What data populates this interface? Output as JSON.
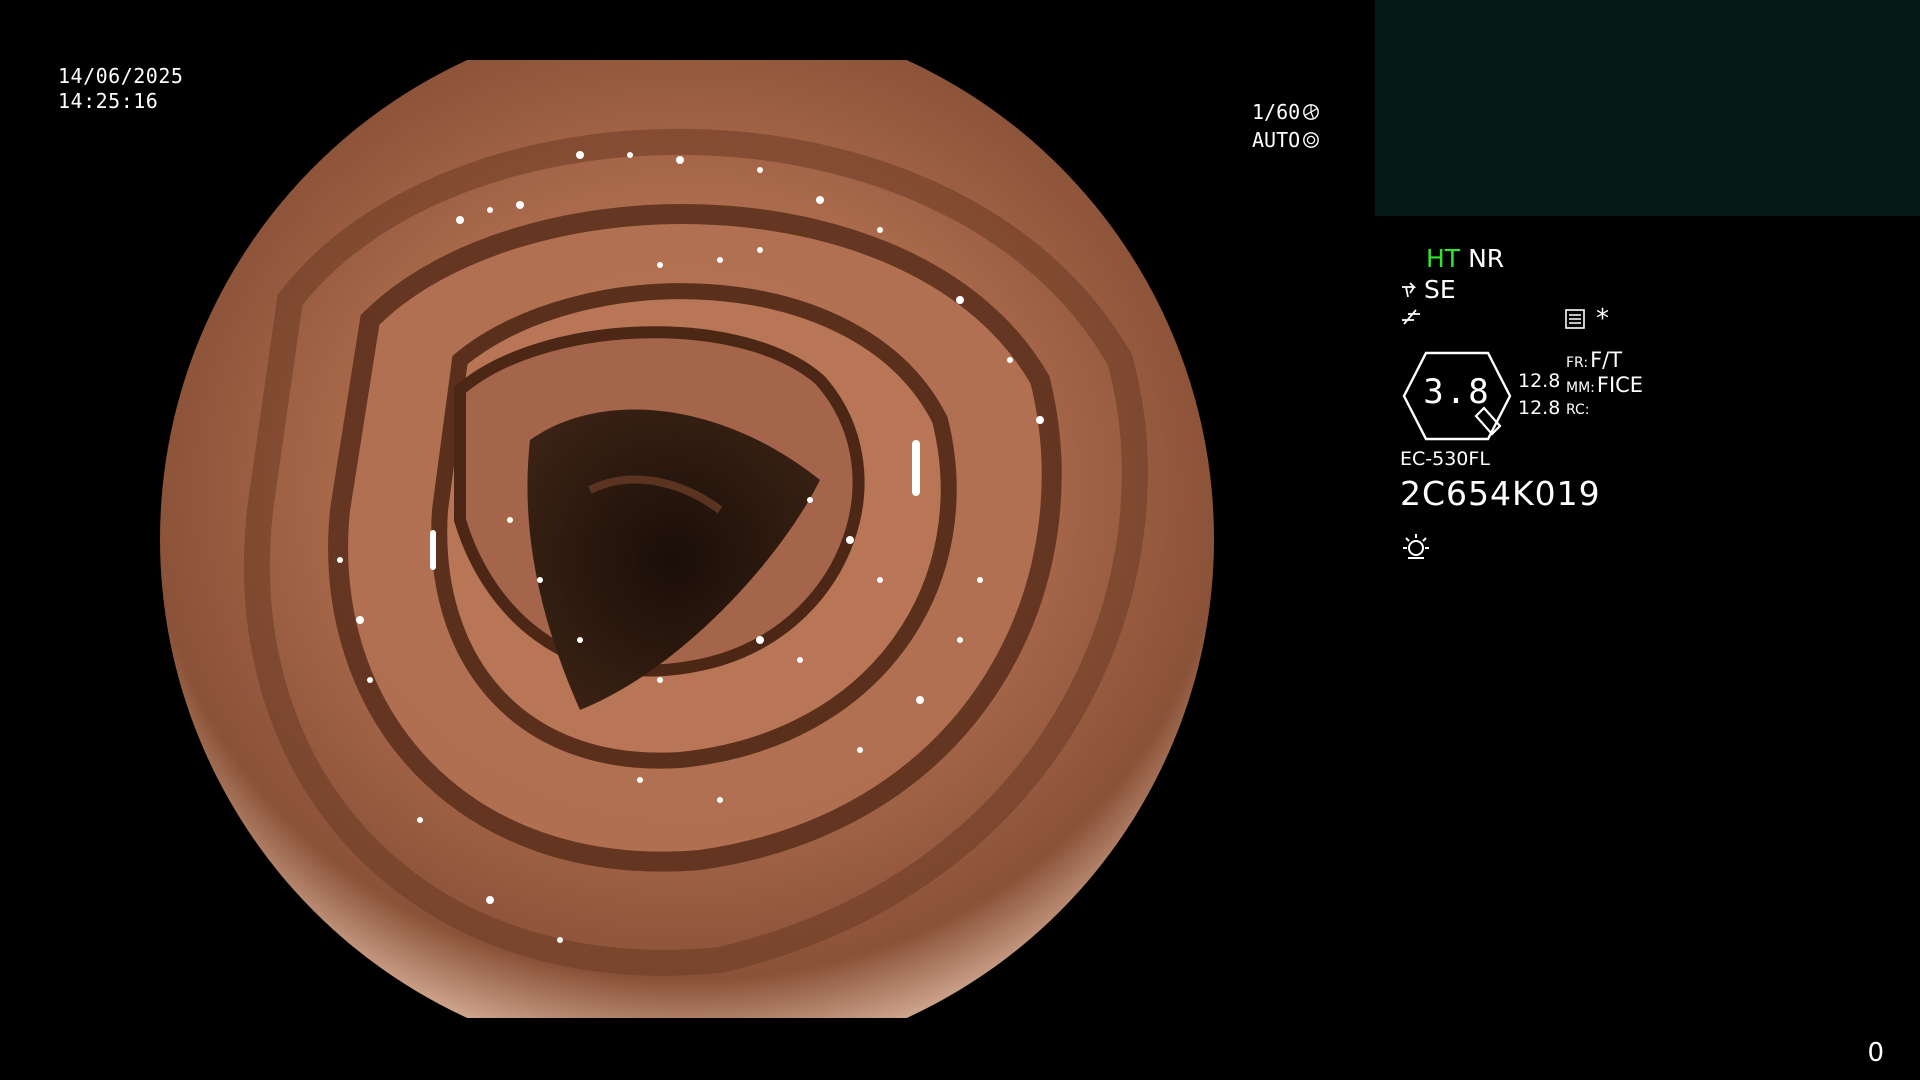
{
  "overlay": {
    "date": "14/06/2025",
    "time": "14:25:16",
    "shutter": "1/60",
    "iris": "AUTO"
  },
  "status": {
    "ht": "HT",
    "nr": "NR",
    "se": "SE",
    "zoom": "3.8",
    "value_1": "12.8",
    "value_2": "12.8",
    "fr_label": "FR:",
    "fr_value": "F/T",
    "mm_label": "MM:",
    "mm_value": "FICE",
    "rc_label": "RC:",
    "asterisk": "*"
  },
  "scope": {
    "model": "EC-530FL",
    "serial": "2C654K019"
  },
  "counter": "0",
  "colors": {
    "background": "#000000",
    "pip_panel": "#031a16",
    "ht_indicator": "#2ee62e",
    "mucosa": "#a86c4c"
  },
  "icons": [
    "shutter-icon",
    "iris-icon",
    "se-icon",
    "fx-icon",
    "menu-icon",
    "zoom-icon",
    "light-icon"
  ]
}
